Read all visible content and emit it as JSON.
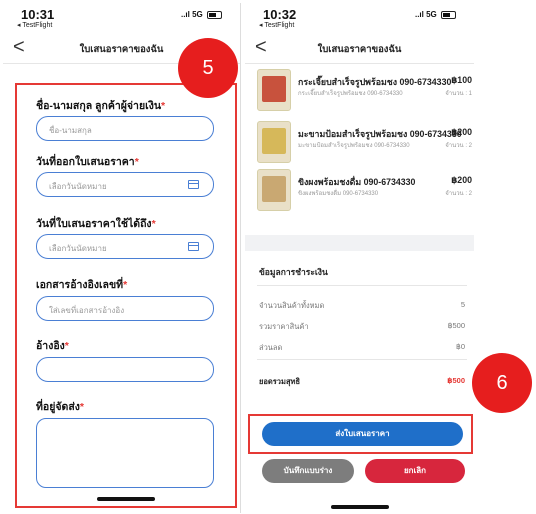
{
  "left": {
    "status": {
      "time": "10:31",
      "back_app": "◂ TestFlight",
      "signal": "..ıl 5G"
    },
    "nav": {
      "title": "ใบเสนอราคาของฉัน",
      "back": "<"
    },
    "badge": "5",
    "form": {
      "customer_label": "ชื่อ-นามสกุล ลูกค้าผู้จ่ายเงิน",
      "customer_placeholder": "ชื่อ-นามสกุล",
      "issue_date_label": "วันที่ออกใบเสนอราคา",
      "issue_date_placeholder": "เลือกวันนัดหมาย",
      "valid_until_label": "วันที่ใบเสนอราคาใช้ได้ถึง",
      "valid_until_placeholder": "เลือกวันนัดหมาย",
      "reference_doc_label": "เอกสารอ้างอิงเลขที่",
      "reference_doc_placeholder": "ใส่เลขที่เอกสารอ้างอิง",
      "reference_label": "อ้างอิง",
      "reference_placeholder": "",
      "address_label": "ที่อยู่จัดส่ง",
      "address_placeholder": "",
      "required_mark": "*"
    }
  },
  "right": {
    "status": {
      "time": "10:32",
      "back_app": "◂ TestFlight",
      "signal": "..ıl 5G"
    },
    "nav": {
      "title": "ใบเสนอราคาของฉัน",
      "back": "<"
    },
    "badge": "6",
    "products": [
      {
        "name": "กระเจี๊ยบสำเร็จรูปพร้อมชง 090-6734330",
        "sub": "กระเจี๊ยบสำเร็จรูปพร้อมชง 090-6734330",
        "price": "฿100",
        "qty": "จำนวน : 1"
      },
      {
        "name": "มะขามป้อมสำเร็จรูปพร้อมชง 090-6734330",
        "sub": "มะขามป้อมสำเร็จรูปพร้อมชง 090-6734330",
        "price": "฿200",
        "qty": "จำนวน : 2"
      },
      {
        "name": "ขิงผงพร้อมชงดื่ม 090-6734330",
        "sub": "ขิงผงพร้อมชงดื่ม 090-6734330",
        "price": "฿200",
        "qty": "จำนวน : 2"
      }
    ],
    "summary": {
      "title": "ข้อมูลการชำระเงิน",
      "rows": [
        {
          "label": "จำนวนสินค้าทั้งหมด",
          "value": "5"
        },
        {
          "label": "รวมราคาสินค้า",
          "value": "฿500"
        },
        {
          "label": "ส่วนลด",
          "value": "฿0"
        }
      ],
      "total_label": "ยอดรวมสุทธิ",
      "total_value": "฿500"
    },
    "buttons": {
      "send": "ส่งใบเสนอราคา",
      "draft": "บันทึกแบบร่าง",
      "cancel": "ยกเลิก"
    }
  },
  "colors": {
    "required": "#e53935",
    "accent_blue": "#1f6fc9",
    "badge_red": "#e61e1e",
    "cancel_red": "#d7263d",
    "draft_gray": "#7d7d7d"
  }
}
